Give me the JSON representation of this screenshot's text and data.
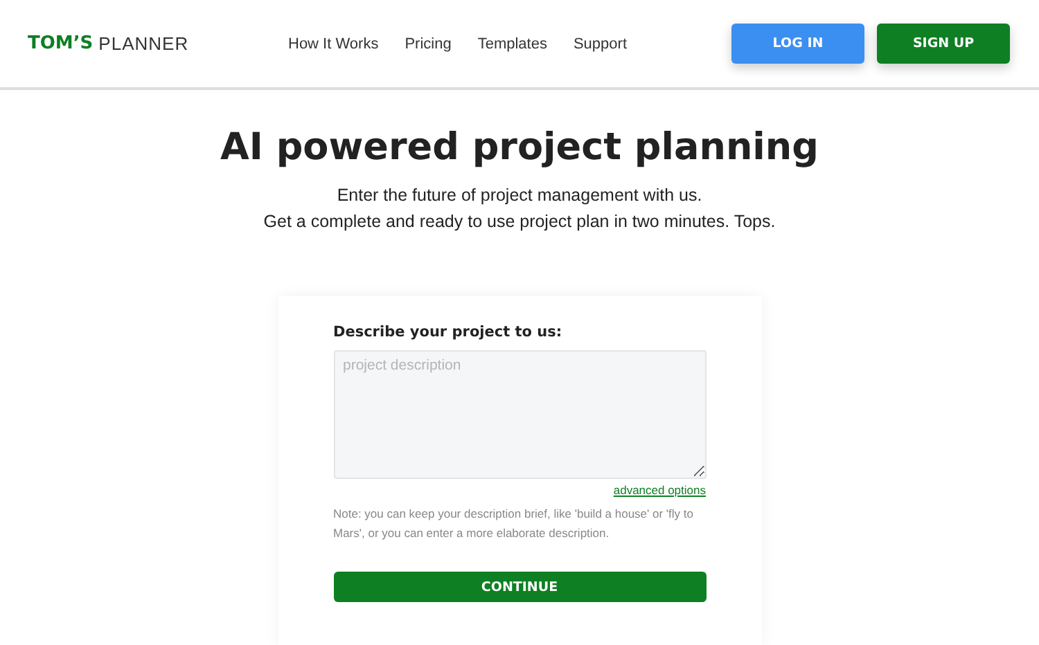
{
  "header": {
    "logo": {
      "bold": "TOM’S",
      "light": "PLANNER"
    },
    "nav": [
      "How It Works",
      "Pricing",
      "Templates",
      "Support"
    ],
    "buttons": [
      {
        "label": "LOG IN",
        "kind": "secondary"
      },
      {
        "label": "SIGN UP",
        "kind": "primary"
      }
    ]
  },
  "hero": {
    "title": "AI powered project planning",
    "subtitles": [
      "Enter the future of project management with us.",
      "Get a complete and ready to use project plan in two minutes. Tops."
    ]
  },
  "form": {
    "label": "Describe your project to us:",
    "description": {
      "placeholder": "project description"
    },
    "advanced_link": "advanced options",
    "note": "Note: you can keep your description brief, like 'build a house' or 'fly to Mars', or you can enter a more elaborate description.",
    "submit": "CONTINUE"
  }
}
